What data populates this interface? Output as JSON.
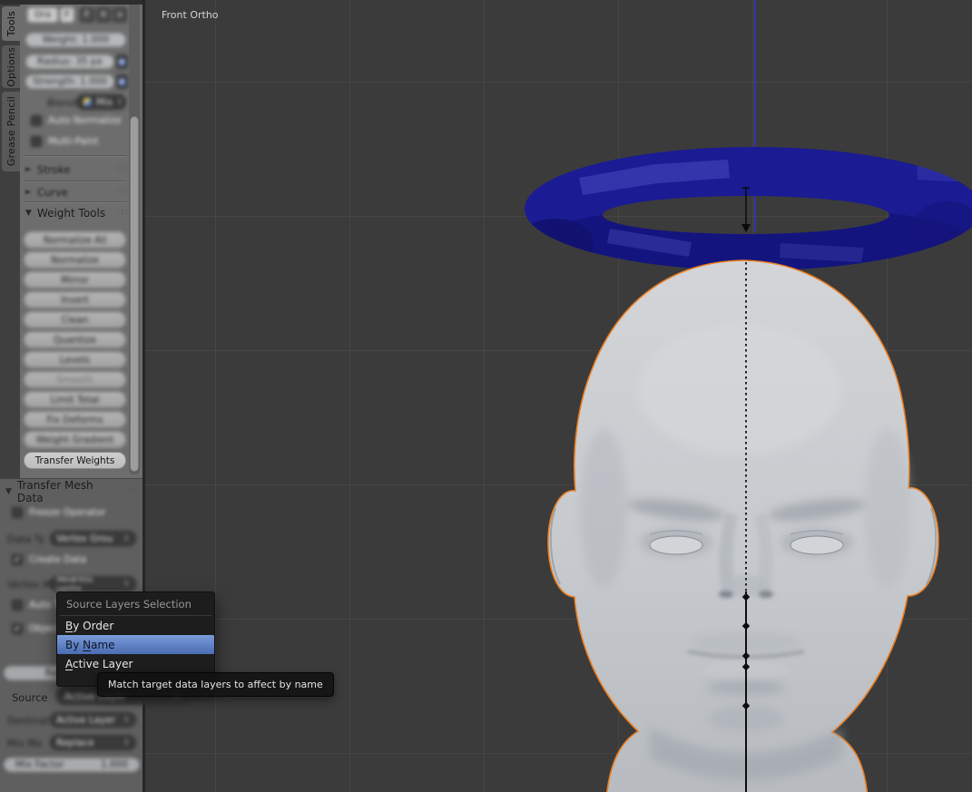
{
  "icons": {
    "triangle_open": "▼",
    "triangle_closed": "►",
    "grip": "∷∷",
    "updown": "↕",
    "check": "✓"
  },
  "tabs": {
    "items": [
      {
        "label": "Tools",
        "active": true
      },
      {
        "label": "Options",
        "active": false
      },
      {
        "label": "Grease Pencil",
        "active": false
      }
    ]
  },
  "brush_panel": {
    "buttons": [
      "Dra",
      "F",
      "F",
      "✕",
      "+"
    ],
    "weight": "Weight: 1.000",
    "radius": "Radius: 35 px",
    "strength": "Strength: 1.000",
    "blend_label": "Blend:",
    "blend_value": "Mix",
    "auto_normalize": {
      "label": "Auto Normalize",
      "glyph": ""
    },
    "multi_paint": {
      "label": "Multi-Paint",
      "glyph": ""
    }
  },
  "shelf_panels": {
    "stroke": "Stroke",
    "curve": "Curve",
    "weight_tools": "Weight Tools",
    "buttons": [
      "Normalize All",
      "Normalize",
      "Mirror",
      "Invert",
      "Clean",
      "Quantize",
      "Levels",
      "Smooth",
      "Limit Total",
      "Fix Deforms",
      "Weight Gradient"
    ],
    "transfer_weights": "Transfer Weights"
  },
  "redo_panel": {
    "title": "Transfer Mesh Data",
    "freeze": {
      "label": "Freeze Operator",
      "glyph": ""
    },
    "data_type_label": "Data Ty",
    "data_type_value": "Vertex Grou",
    "create": {
      "label": "Create Data",
      "glyph": "✓"
    },
    "vertex_map_label": "Vertex M",
    "vertex_map_value": "Nearest verte",
    "auto_transform": {
      "label": "Auto Transfo",
      "glyph": ""
    },
    "object_transform": {
      "label": "Object Tran",
      "glyph": "✓"
    },
    "ray_radius": "Ray Radius",
    "source_label": "Source",
    "source_value": "Active Layer",
    "dest_label": "Destinat",
    "dest_value": "Active Layer",
    "mix_mode_label": "Mix Mo",
    "mix_mode_value": "Replace",
    "mix_factor_label": "Mix Factor",
    "mix_factor_value": "1.000"
  },
  "menu": {
    "header": "Source Layers Selection",
    "items": [
      {
        "pre": "",
        "key": "B",
        "post": "y Order",
        "selected": false
      },
      {
        "pre": "By ",
        "key": "N",
        "post": "ame",
        "selected": true
      },
      {
        "pre": "",
        "key": "A",
        "post": "ctive Layer",
        "selected": false
      }
    ]
  },
  "tooltip": {
    "text": "Match target data layers to affect by name"
  },
  "viewport": {
    "view_label": "Front Ortho",
    "colors": {
      "background": "#3b3b3b",
      "selection_outline": "#ed7f21",
      "halo_blue": "#1b1b94",
      "axis_blue": "#3434c4",
      "head_gray": "#c6c9cd"
    }
  }
}
